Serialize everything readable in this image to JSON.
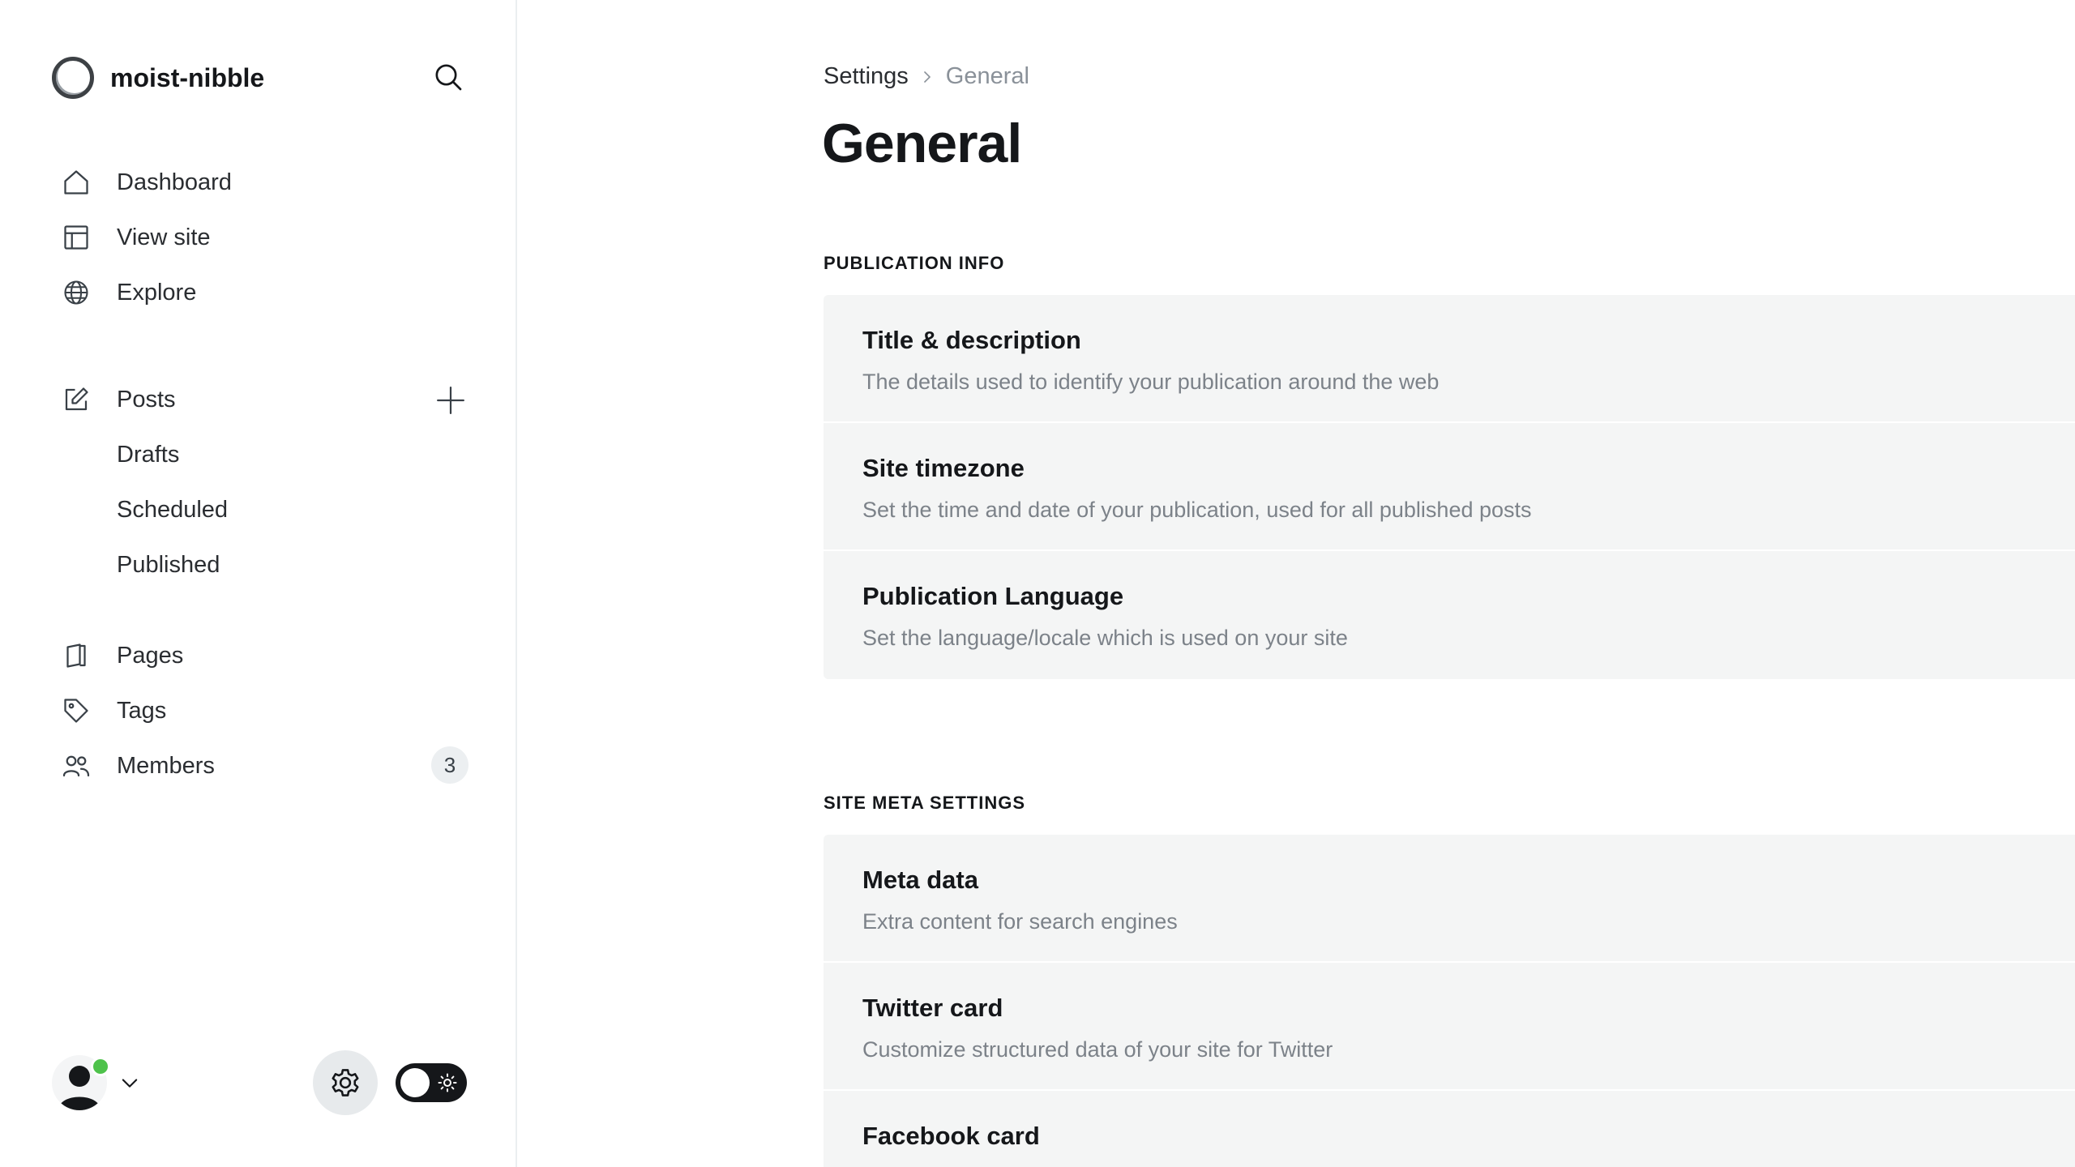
{
  "sidebar": {
    "site_name": "moist-nibble",
    "nav": [
      {
        "label": "Dashboard",
        "icon": "home-icon"
      },
      {
        "label": "View site",
        "icon": "layout-icon"
      },
      {
        "label": "Explore",
        "icon": "globe-icon"
      }
    ],
    "posts": {
      "label": "Posts",
      "icon": "pencil-icon",
      "sub": [
        {
          "label": "Drafts"
        },
        {
          "label": "Scheduled"
        },
        {
          "label": "Published"
        }
      ]
    },
    "more": [
      {
        "label": "Pages",
        "icon": "page-icon"
      },
      {
        "label": "Tags",
        "icon": "tag-icon"
      },
      {
        "label": "Members",
        "icon": "users-icon",
        "count": "3"
      }
    ]
  },
  "breadcrumb": {
    "parent": "Settings",
    "current": "General"
  },
  "page": {
    "title": "General"
  },
  "sections": [
    {
      "title": "PUBLICATION INFO",
      "rows": [
        {
          "title": "Title & description",
          "desc": "The details used to identify your publication around the web"
        },
        {
          "title": "Site timezone",
          "desc": "Set the time and date of your publication, used for all published posts"
        },
        {
          "title": "Publication Language",
          "desc": "Set the language/locale which is used on your site"
        }
      ]
    },
    {
      "title": "SITE META SETTINGS",
      "rows": [
        {
          "title": "Meta data",
          "desc": "Extra content for search engines"
        },
        {
          "title": "Twitter card",
          "desc": "Customize structured data of your site for Twitter"
        },
        {
          "title": "Facebook card",
          "desc": ""
        }
      ]
    }
  ],
  "colors": {
    "accent": "#15171a",
    "online": "#4ec24b",
    "row_bg": "#f4f5f5",
    "muted_text": "#7c8289"
  }
}
